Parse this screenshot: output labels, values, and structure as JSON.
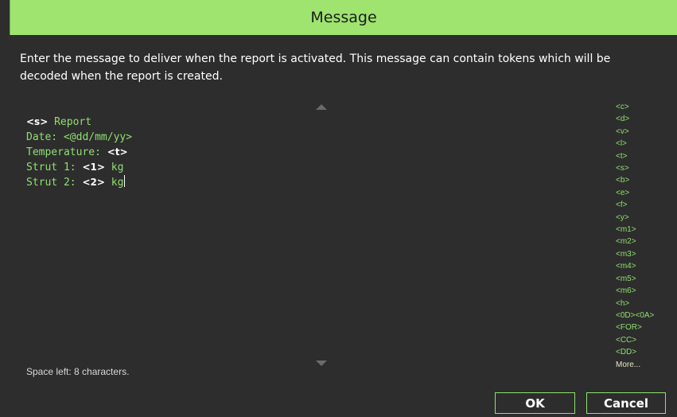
{
  "dialog": {
    "title": "Message",
    "instructions_line1": "Enter the message to deliver when the report is activated. This message can contain tokens which will be",
    "instructions_line2": "decoded when the report is created."
  },
  "editor": {
    "lines": [
      [
        {
          "t": "<s>",
          "tok": true
        },
        {
          "t": " Report",
          "tok": false
        }
      ],
      [
        {
          "t": "Date: <@dd/mm/yy>",
          "tok": false
        }
      ],
      [
        {
          "t": "Temperature: ",
          "tok": false
        },
        {
          "t": "<t>",
          "tok": true
        }
      ],
      [
        {
          "t": "Strut 1: ",
          "tok": false
        },
        {
          "t": "<1>",
          "tok": true
        },
        {
          "t": " kg",
          "tok": false
        }
      ],
      [
        {
          "t": "Strut 2: ",
          "tok": false
        },
        {
          "t": "<2>",
          "tok": true
        },
        {
          "t": " kg",
          "tok": false
        }
      ]
    ]
  },
  "status": {
    "space_left": "Space left: 8 characters."
  },
  "tokens": [
    "<c>",
    "<d>",
    "<v>",
    "<l>",
    "<t>",
    "<s>",
    "<b>",
    "<e>",
    "<f>",
    "<y>",
    "<m1>",
    "<m2>",
    "<m3>",
    "<m4>",
    "<m5>",
    "<m6>",
    "<h>",
    "<0D><0A>",
    "<FOR>",
    "<CC>",
    "<DD>"
  ],
  "tokens_more": "More...",
  "buttons": {
    "ok": "OK",
    "cancel": "Cancel"
  },
  "colors": {
    "title_bar": "#9ee46f",
    "accent_green": "#8fe070",
    "background": "#2d2d2d"
  }
}
